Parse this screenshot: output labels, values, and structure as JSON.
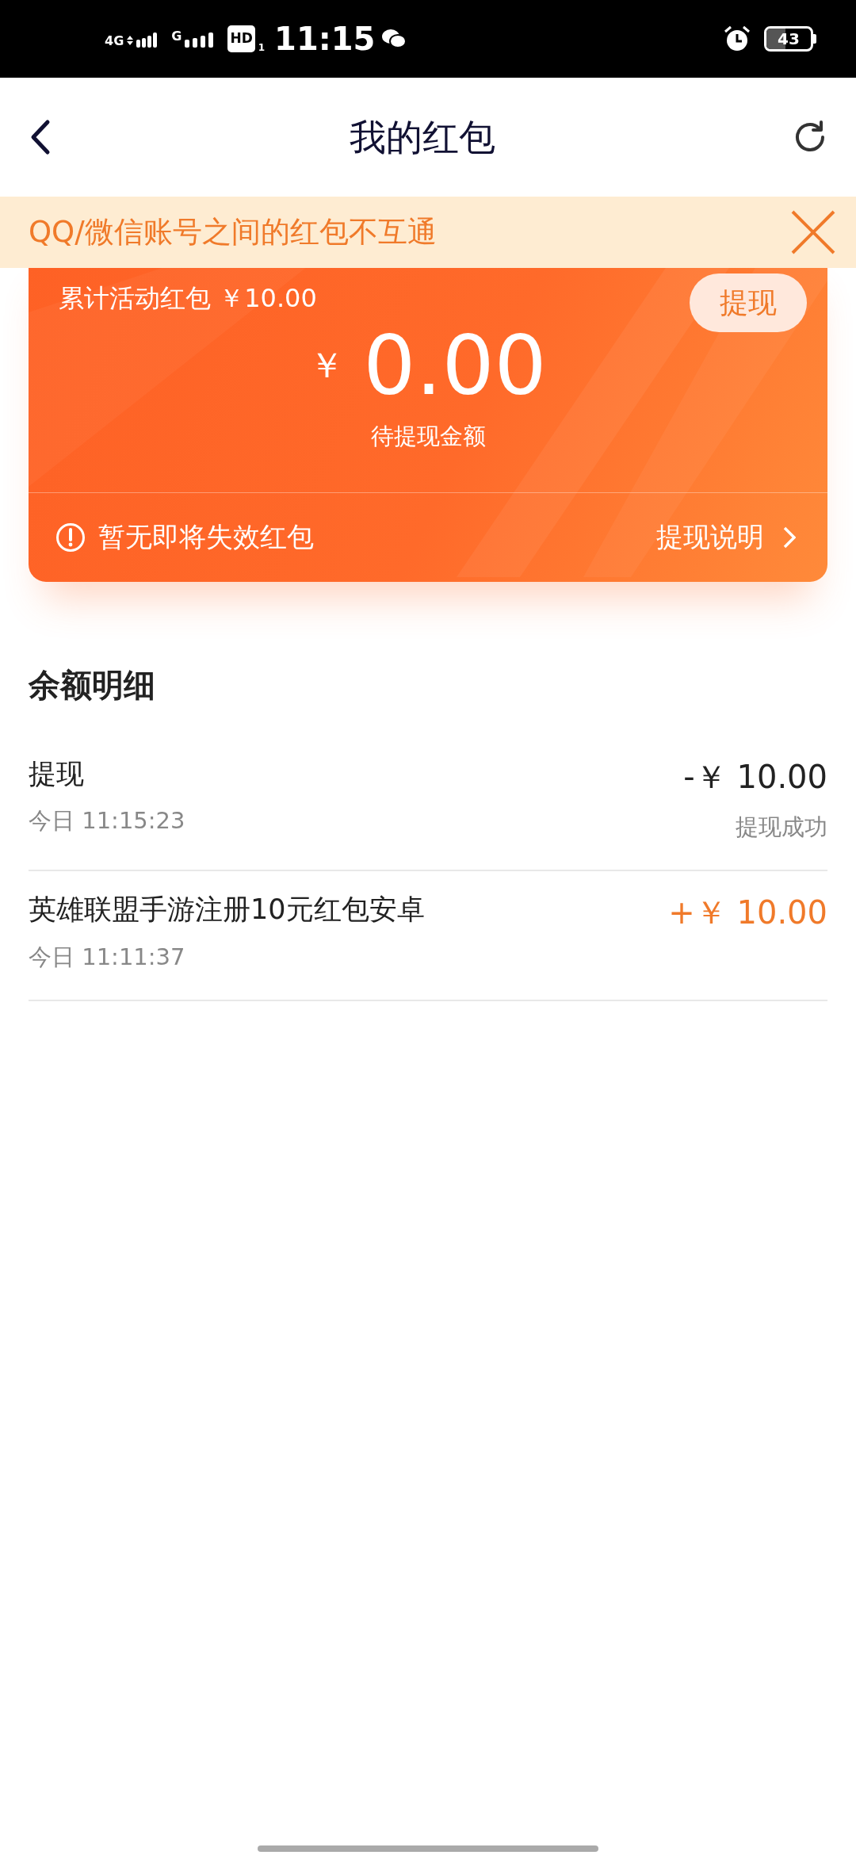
{
  "status_bar": {
    "network_1": "4G",
    "network_2": "G",
    "hd": "HD",
    "hd_sub": "1",
    "time": "11:15",
    "battery": "43"
  },
  "header": {
    "title": "我的红包"
  },
  "notice": {
    "text": "QQ/微信账号之间的红包不互通"
  },
  "card": {
    "total_label": "累计活动红包",
    "total_amount": "￥10.00",
    "withdraw_button": "提现",
    "currency": "￥",
    "balance": "0.00",
    "balance_label": "待提现金额",
    "expiry_text": "暂无即将失效红包",
    "help_link": "提现说明"
  },
  "details": {
    "title": "余额明细",
    "rows": [
      {
        "title": "提现",
        "time": "今日 11:15:23",
        "amount": "-￥ 10.00",
        "kind": "debit",
        "status": "提现成功"
      },
      {
        "title": "英雄联盟手游注册10元红包安卓",
        "time": "今日 11:11:37",
        "amount": "+￥ 10.00",
        "kind": "credit"
      }
    ]
  }
}
